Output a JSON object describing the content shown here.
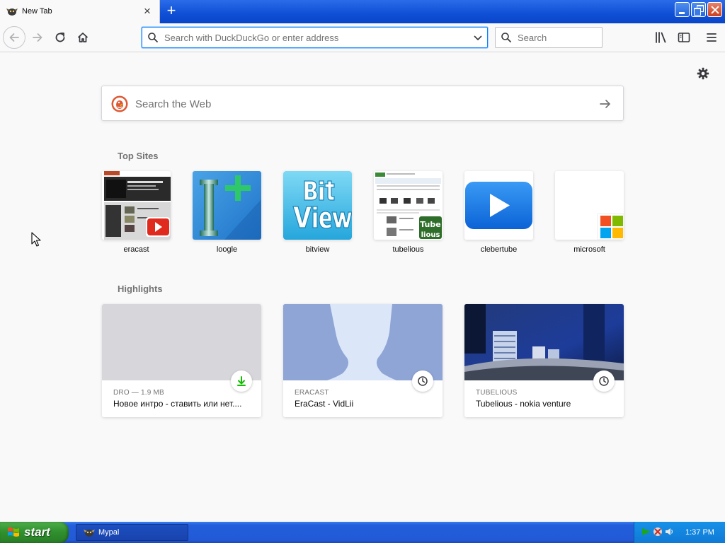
{
  "browser": {
    "tab": {
      "title": "New Tab",
      "close_glyph": "×"
    },
    "new_tab_glyph": "+",
    "urlbar": {
      "placeholder": "Search with DuckDuckGo or enter address",
      "value": ""
    },
    "searchbar": {
      "placeholder": "Search",
      "value": ""
    }
  },
  "newtab": {
    "web_search": {
      "placeholder": "Search the Web"
    },
    "top_sites_title": "Top Sites",
    "top_sites": [
      {
        "label": "eracast"
      },
      {
        "label": "loogle"
      },
      {
        "label": "bitview"
      },
      {
        "label": "tubelious"
      },
      {
        "label": "clebertube"
      },
      {
        "label": "microsoft"
      }
    ],
    "highlights_title": "Highlights",
    "highlights": [
      {
        "context": "DRO — 1.9 MB",
        "title": "Новое интро - ставить или нет....",
        "badge": "download-icon"
      },
      {
        "context": "ERACAST",
        "title": "EraCast - VidLii",
        "badge": "clock-icon"
      },
      {
        "context": "TUBELIOUS",
        "title": "Tubelious - nokia venture",
        "badge": "clock-icon"
      }
    ]
  },
  "taskbar": {
    "start_label": "start",
    "task_label": "Mypal",
    "clock": "1:37 PM"
  },
  "colors": {
    "accent": "#0a84ff",
    "taskbar_blue": "#245edb",
    "start_green": "#2f8f2d",
    "download_green": "#12bc00"
  }
}
